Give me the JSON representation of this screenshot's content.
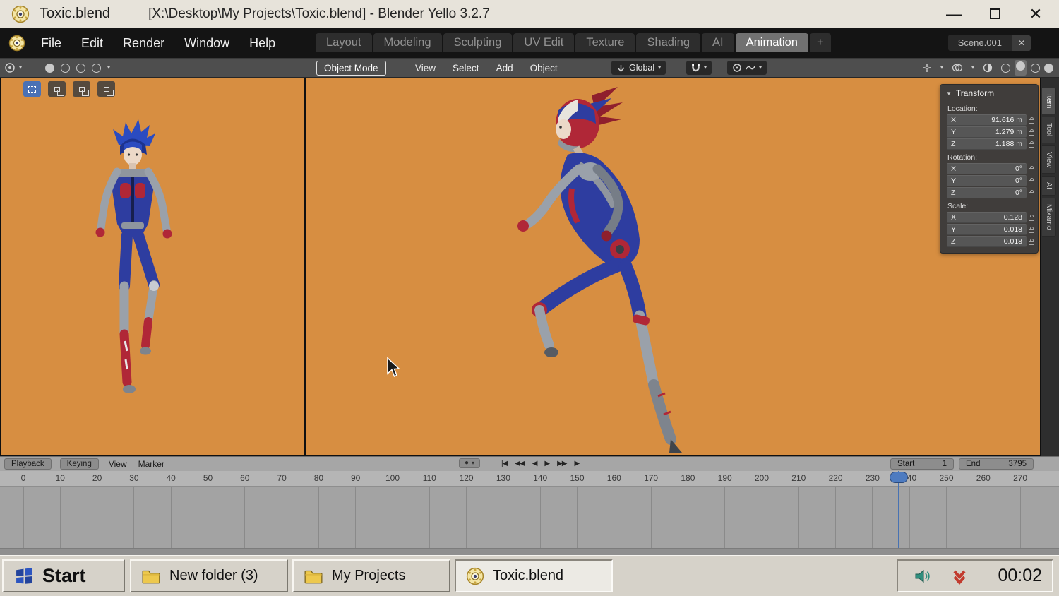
{
  "colors": {
    "viewport_bg": "#d78e41",
    "accent_blue": "#4772b3",
    "taskbar_bg": "#d6d2c9",
    "menubar_bg": "#141414"
  },
  "icons": {
    "chevron": "▾",
    "collapse": "▼",
    "close": "✕",
    "minimize": "—",
    "record": "●",
    "plus": "+"
  },
  "titlebar": {
    "app_title": "Toxic.blend",
    "document_title": "[X:\\Desktop\\My Projects\\Toxic.blend] - Blender Yello 3.2.7"
  },
  "menubar": {
    "menus": [
      "File",
      "Edit",
      "Render",
      "Window",
      "Help"
    ],
    "workspaces": [
      "Layout",
      "Modeling",
      "Sculpting",
      "UV Edit",
      "Texture",
      "Shading",
      "AI",
      "Animation"
    ],
    "active_workspace": "Animation",
    "add_tab": "+",
    "scene_name": "Scene.001"
  },
  "toolbar": {
    "mode": "Object Mode",
    "menus": [
      "View",
      "Select",
      "Add",
      "Object"
    ],
    "orientation": "Global"
  },
  "transform_panel": {
    "title": "Transform",
    "sections": [
      {
        "label": "Location:",
        "rows": [
          {
            "axis": "X",
            "value": "91.616 m"
          },
          {
            "axis": "Y",
            "value": "1.279 m"
          },
          {
            "axis": "Z",
            "value": "1.188 m"
          }
        ]
      },
      {
        "label": "Rotation:",
        "rows": [
          {
            "axis": "X",
            "value": "0°"
          },
          {
            "axis": "Y",
            "value": "0°"
          },
          {
            "axis": "Z",
            "value": "0°"
          }
        ]
      },
      {
        "label": "Scale:",
        "rows": [
          {
            "axis": "X",
            "value": "0.128"
          },
          {
            "axis": "Y",
            "value": "0.018"
          },
          {
            "axis": "Z",
            "value": "0.018"
          }
        ]
      }
    ],
    "tabs": [
      "Item",
      "Tool",
      "View",
      "AI",
      "Mixamo"
    ],
    "active_tab": "Item"
  },
  "timeline": {
    "menus": [
      {
        "label": "Playback",
        "style": "button"
      },
      {
        "label": "Keying",
        "style": "button"
      },
      {
        "label": "View",
        "style": "flat"
      },
      {
        "label": "Marker",
        "style": "flat"
      }
    ],
    "transport": [
      {
        "name": "jump-to-start",
        "glyph": "|◀"
      },
      {
        "name": "previous-keyframe",
        "glyph": "◀◀"
      },
      {
        "name": "play-reverse",
        "glyph": "◀"
      },
      {
        "name": "play",
        "glyph": "▶"
      },
      {
        "name": "next-keyframe",
        "glyph": "▶▶"
      },
      {
        "name": "jump-to-end",
        "glyph": "▶|"
      }
    ],
    "ticks": [
      0,
      10,
      20,
      30,
      40,
      50,
      60,
      70,
      80,
      90,
      100,
      110,
      120,
      130,
      140,
      150,
      160,
      170,
      180,
      190,
      200,
      210,
      220,
      230,
      240,
      250,
      260,
      270
    ],
    "current_frame": 237,
    "start_label": "Start",
    "start_value": "1",
    "end_label": "End",
    "end_value": "3795"
  },
  "taskbar": {
    "start_label": "Start",
    "buttons": [
      {
        "label": "New folder (3)",
        "icon": "folder",
        "active": false
      },
      {
        "label": "My Projects",
        "icon": "folder",
        "active": false
      },
      {
        "label": "Toxic.blend",
        "icon": "blender",
        "active": true
      }
    ],
    "clock": "00:02"
  }
}
